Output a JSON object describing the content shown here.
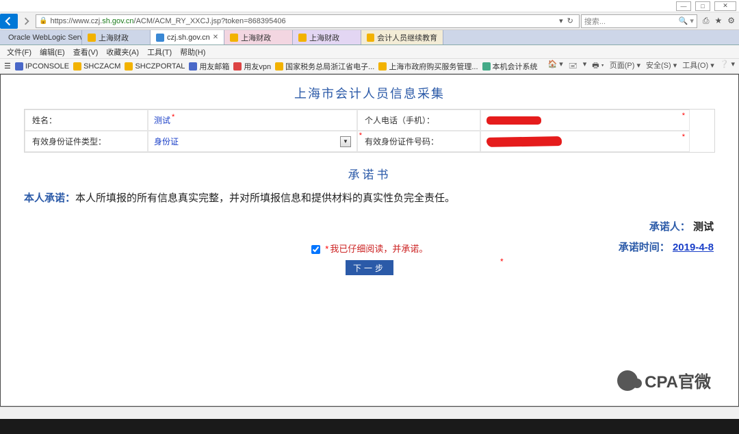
{
  "window": {
    "minimize": "—",
    "maximize": "□",
    "close": "✕"
  },
  "nav": {
    "url_prefix": "https://www.czj.",
    "url_host": "sh.gov.cn",
    "url_rest": "/ACM/ACM_RY_XXCJ.jsp?token=868395406",
    "search_placeholder": "搜索..."
  },
  "tabs": [
    {
      "label": "Oracle WebLogic Server Ad...",
      "cls": ""
    },
    {
      "label": "上海财政",
      "cls": ""
    },
    {
      "label": "czj.sh.gov.cn",
      "cls": "active"
    },
    {
      "label": "上海财政",
      "cls": "sh1"
    },
    {
      "label": "上海财政",
      "cls": "sh2"
    },
    {
      "label": "会计人员继续教育",
      "cls": "sh3"
    }
  ],
  "menu": [
    "文件(F)",
    "编辑(E)",
    "查看(V)",
    "收藏夹(A)",
    "工具(T)",
    "帮助(H)"
  ],
  "fav": [
    {
      "label": "IPCONSOLE",
      "ico": "blue2"
    },
    {
      "label": "SHCZACM",
      "ico": "orange"
    },
    {
      "label": "SHCZPORTAL",
      "ico": "orange"
    },
    {
      "label": "用友邮箱",
      "ico": "blue2"
    },
    {
      "label": "用友vpn",
      "ico": "red"
    },
    {
      "label": "国家税务总局浙江省电子...",
      "ico": "orange"
    },
    {
      "label": "上海市政府购买服务管理...",
      "ico": "orange"
    },
    {
      "label": "本机会计系统",
      "ico": "green"
    }
  ],
  "favright": [
    "🏠 ▾",
    "🖃",
    "▾",
    "🖶 ▾",
    "页面(P) ▾",
    "安全(S) ▾",
    "工具(O) ▾",
    "❔ ▾"
  ],
  "page": {
    "title": "上海市会计人员信息采集",
    "fields": {
      "name_label": "姓名：",
      "name_value": "测试",
      "phone_label": "个人电话（手机）：",
      "idtype_label": "有效身份证件类型：",
      "idtype_value": "身份证",
      "idno_label": "有效身份证件号码："
    },
    "commit_title": "承诺书",
    "commit_lead": "本人承诺：",
    "commit_body": "本人所填报的所有信息真实完整，并对所填报信息和提供材料的真实性负完全责任。",
    "signer_label": "承诺人：",
    "signer_value": "测试",
    "time_label": "承诺时间：",
    "time_value": "2019-4-8",
    "confirm_label": "我已仔细阅读，并承诺。",
    "next_btn": "下一步"
  },
  "watermark": "CPA官微"
}
